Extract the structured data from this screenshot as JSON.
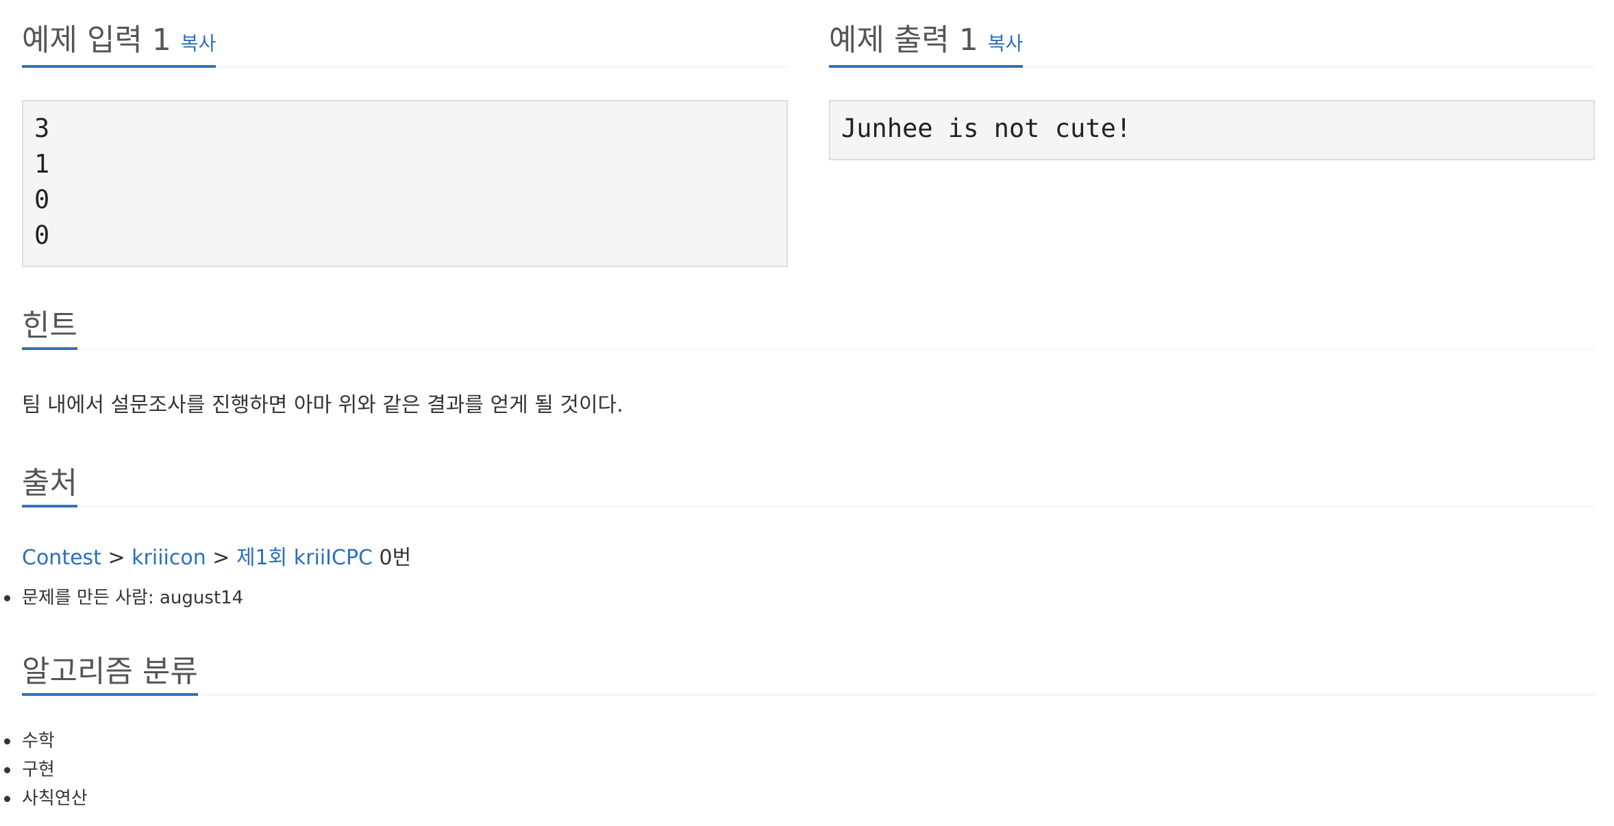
{
  "sample_input": {
    "title": "예제 입력 1",
    "copy_label": "복사",
    "lines": [
      "3",
      "1",
      "0",
      "0"
    ]
  },
  "sample_output": {
    "title": "예제 출력 1",
    "copy_label": "복사",
    "lines": [
      "Junhee is not cute!"
    ]
  },
  "hint": {
    "title": "힌트",
    "text": "팀 내에서 설문조사를 진행하면 아마 위와 같은 결과를 얻게 될 것이다."
  },
  "source": {
    "title": "출처",
    "breadcrumb": {
      "contest": "Contest",
      "sep1": " > ",
      "kriiicon": "kriiicon",
      "sep2": " > ",
      "event": "제1회 kriiICPC",
      "suffix": " 0번"
    },
    "author_label": "문제를 만든 사람: ",
    "author": "august14"
  },
  "algorithms": {
    "title": "알고리즘 분류",
    "items": [
      "수학",
      "구현",
      "사칙연산"
    ]
  },
  "colors": {
    "accent": "#3371b6",
    "link": "#2b6fbf"
  }
}
